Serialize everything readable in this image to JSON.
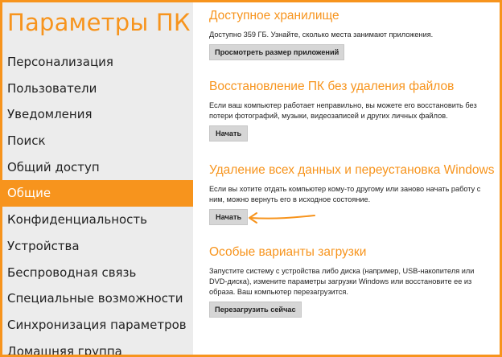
{
  "app": {
    "title": "Параметры ПК"
  },
  "sidebar": {
    "items": [
      {
        "label": "Персонализация",
        "active": false
      },
      {
        "label": "Пользователи",
        "active": false
      },
      {
        "label": "Уведомления",
        "active": false
      },
      {
        "label": "Поиск",
        "active": false
      },
      {
        "label": "Общий доступ",
        "active": false
      },
      {
        "label": "Общие",
        "active": true
      },
      {
        "label": "Конфиденциальность",
        "active": false
      },
      {
        "label": "Устройства",
        "active": false
      },
      {
        "label": "Беспроводная связь",
        "active": false
      },
      {
        "label": "Специальные возможности",
        "active": false
      },
      {
        "label": "Синхронизация параметров",
        "active": false
      },
      {
        "label": "Домашняя группа",
        "active": false
      }
    ]
  },
  "sections": {
    "storage": {
      "title": "Доступное хранилище",
      "desc": "Доступно 359 ГБ. Узнайте, сколько места занимают приложения.",
      "button": "Просмотреть размер приложений"
    },
    "refresh": {
      "title": "Восстановление ПК без удаления файлов",
      "desc": "Если ваш компьютер работает неправильно, вы можете его восстановить без потери фотографий, музыки, видеозаписей и других личных файлов.",
      "button": "Начать"
    },
    "reset": {
      "title": "Удаление всех данных и переустановка Windows",
      "desc": "Если вы хотите отдать компьютер кому-то другому или заново начать работу с ним, можно вернуть его в исходное состояние.",
      "button": "Начать"
    },
    "startup": {
      "title": "Особые варианты загрузки",
      "desc": "Запустите систему с устройства либо диска (например, USB-накопителя или DVD-диска), измените параметры загрузки Windows или восстановите ее из образа. Ваш компьютер перезагрузится.",
      "button": "Перезагрузить сейчас"
    }
  },
  "colors": {
    "accent": "#f7941d",
    "sidebar_bg": "#ececec",
    "button_bg": "#d6d6d6"
  }
}
